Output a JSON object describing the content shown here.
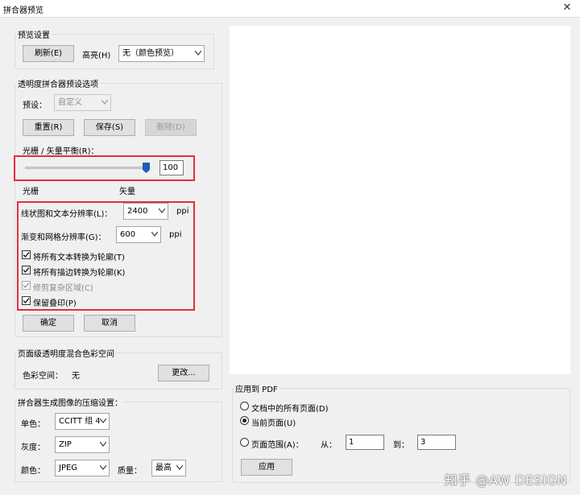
{
  "window": {
    "title": "拼合器预览"
  },
  "preview_settings": {
    "group_label": "预览设置",
    "refresh_label": "刷新(E)",
    "highlight_label": "高亮(H)",
    "highlight_value": "无（颜色预览）"
  },
  "presets": {
    "group_label": "透明度拼合器预设选项",
    "preset_label": "预设：",
    "preset_value": "自定义",
    "reset_label": "重置(R)",
    "save_label": "保存(S)",
    "delete_label": "删除(D)",
    "balance_label": "光栅 / 矢量平衡(R)：",
    "balance_value": "100",
    "balance_fraction": 1.0,
    "raster_label": "光栅",
    "vector_label": "矢量",
    "line_res_label": "线状图和文本分辨率(L)：",
    "line_res_value": "2400",
    "line_res_unit": "ppi",
    "gradient_res_label": "渐变和网格分辨率(G)：",
    "gradient_res_value": "600",
    "gradient_res_unit": "ppi",
    "checkboxes": [
      {
        "label": "将所有文本转换为轮廓(T)",
        "checked": true,
        "disabled": false
      },
      {
        "label": "将所有描边转换为轮廓(K)",
        "checked": true,
        "disabled": false
      },
      {
        "label": "修剪复杂区域(C)",
        "checked": true,
        "disabled": true
      },
      {
        "label": "保留叠印(P)",
        "checked": true,
        "disabled": false
      }
    ],
    "ok_label": "确定",
    "cancel_label": "取消"
  },
  "color_space": {
    "group_label": "页面级透明度混合色彩空间",
    "label": "色彩空间：",
    "value": "无",
    "change_label": "更改..."
  },
  "compression": {
    "group_label": "拼合器生成图像的压缩设置：",
    "mono_label": "单色：",
    "mono_value": "CCITT 组 4",
    "gray_label": "灰度：",
    "gray_value": "ZIP",
    "color_label": "颜色：",
    "color_value": "JPEG",
    "quality_label": "质量：",
    "quality_value": "最高"
  },
  "apply": {
    "group_label": "应用到 PDF",
    "all_pages_label": "文档中的所有页面(D)",
    "current_page_label": "当前页面(U)",
    "page_range_label": "页面范围(A)：",
    "from_label": "从：",
    "from_value": "1",
    "to_label": "到：",
    "to_value": "3",
    "apply_label": "应用",
    "selected": "current"
  },
  "watermark": "知乎 @AW DESIGN",
  "colors": {
    "highlight_box": "#e0303a",
    "slider_thumb": "#1a5fb4"
  }
}
